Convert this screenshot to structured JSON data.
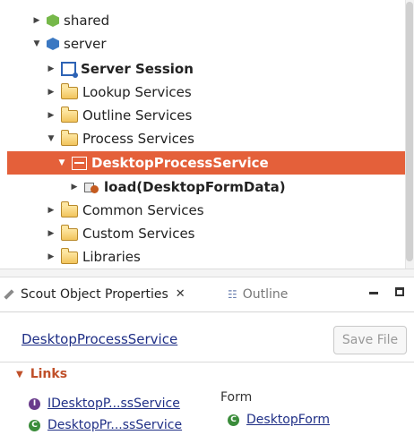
{
  "tree": {
    "items": [
      {
        "label": "shared",
        "icon": "package-icon",
        "expanded": false
      },
      {
        "label": "server",
        "icon": "package-icon",
        "expanded": true
      },
      {
        "label": "Server Session",
        "icon": "session-icon",
        "expanded": false
      },
      {
        "label": "Lookup Services",
        "icon": "folder-icon",
        "expanded": false
      },
      {
        "label": "Outline Services",
        "icon": "folder-icon",
        "expanded": false
      },
      {
        "label": "Process Services",
        "icon": "folder-icon",
        "expanded": true
      },
      {
        "label": "DesktopProcessService",
        "icon": "service-icon",
        "expanded": true,
        "selected": true
      },
      {
        "label": "load(DesktopFormData)",
        "icon": "method-icon",
        "expanded": false
      },
      {
        "label": "Common Services",
        "icon": "folder-icon",
        "expanded": false
      },
      {
        "label": "Custom Services",
        "icon": "folder-icon",
        "expanded": false
      },
      {
        "label": "Libraries",
        "icon": "folder-icon",
        "expanded": false
      }
    ],
    "selected_color": "#e4603a"
  },
  "properties_view": {
    "tabs": [
      {
        "label": "Scout Object Properties",
        "active": true
      },
      {
        "label": "Outline",
        "active": false
      }
    ],
    "title": "DesktopProcessService",
    "save_button": "Save File",
    "links_section": {
      "header": "Links",
      "items": [
        {
          "label": "IDesktopP...ssService",
          "type": "interface"
        },
        {
          "label": "DesktopPr...ssService",
          "type": "class"
        }
      ],
      "form_label": "Form",
      "form_link": "DesktopForm"
    },
    "link_color": "#1f2f86"
  }
}
